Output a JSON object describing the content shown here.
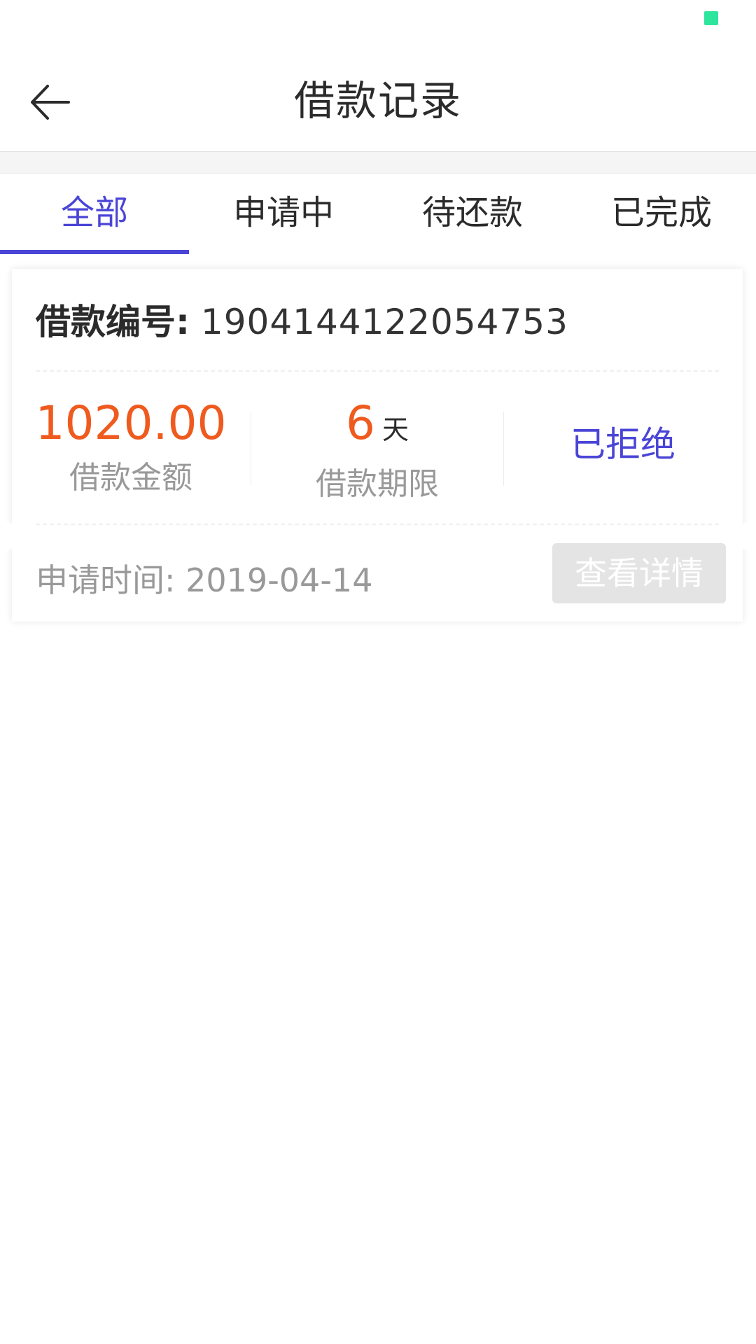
{
  "status_bar": {
    "indicator_color": "#2ee59d"
  },
  "header": {
    "back_icon": "arrow-left-icon",
    "title": "借款记录"
  },
  "tabs": [
    {
      "label": "全部",
      "active": true
    },
    {
      "label": "申请中",
      "active": false
    },
    {
      "label": "待还款",
      "active": false
    },
    {
      "label": "已完成",
      "active": false
    }
  ],
  "colors": {
    "accent": "#4a45d6",
    "amount": "#ef5a1e",
    "muted": "#999999"
  },
  "records": [
    {
      "number_label": "借款编号:",
      "number_value": "1904144122054753",
      "amount_value": "1020.00",
      "amount_label": "借款金额",
      "term_value": "6",
      "term_unit": "天",
      "term_label": "借款期限",
      "status": "已拒绝",
      "apply_time_label": "申请时间:",
      "apply_time_value": "2019-04-14",
      "detail_button": "查看详情"
    }
  ]
}
